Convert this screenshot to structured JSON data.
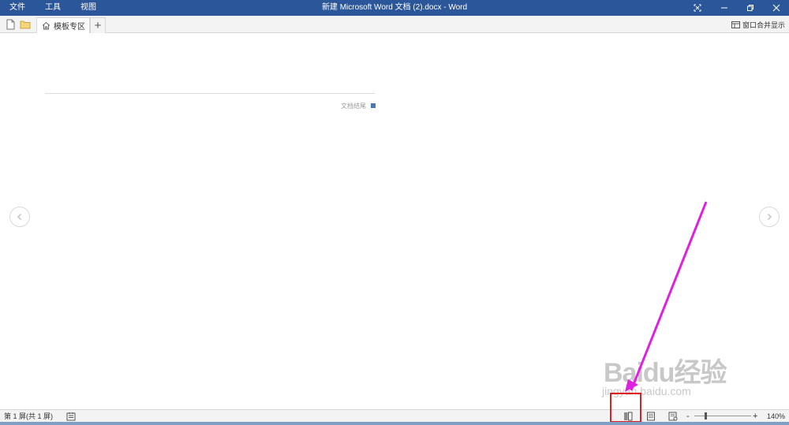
{
  "titlebar": {
    "menus": [
      "文件",
      "工具",
      "视图"
    ],
    "title": "新建 Microsoft Word 文档 (2).docx  -  Word",
    "accent_color": "#2b579a"
  },
  "tabbar": {
    "new_icon": "new-document-icon",
    "open_icon": "folder-icon",
    "tab_label": "模板专区",
    "tab_icon": "home-icon",
    "add_tab": "+",
    "merge_label": "窗口合并显示",
    "merge_icon": "window-icon"
  },
  "document": {
    "end_label": "文档结尾",
    "end_marker_color": "#4a77b4"
  },
  "watermark": {
    "logo": "Baidu经验",
    "url": "jingyan.baidu.com"
  },
  "statusbar": {
    "page_info": "第 1 屏(共 1 屏)",
    "zoom_minus": "-",
    "zoom_plus": "+",
    "zoom_level": "140%",
    "zoom_fraction": 0.18
  },
  "annotation": {
    "arrow_color": "#e020e0",
    "box_color": "#e02020"
  }
}
